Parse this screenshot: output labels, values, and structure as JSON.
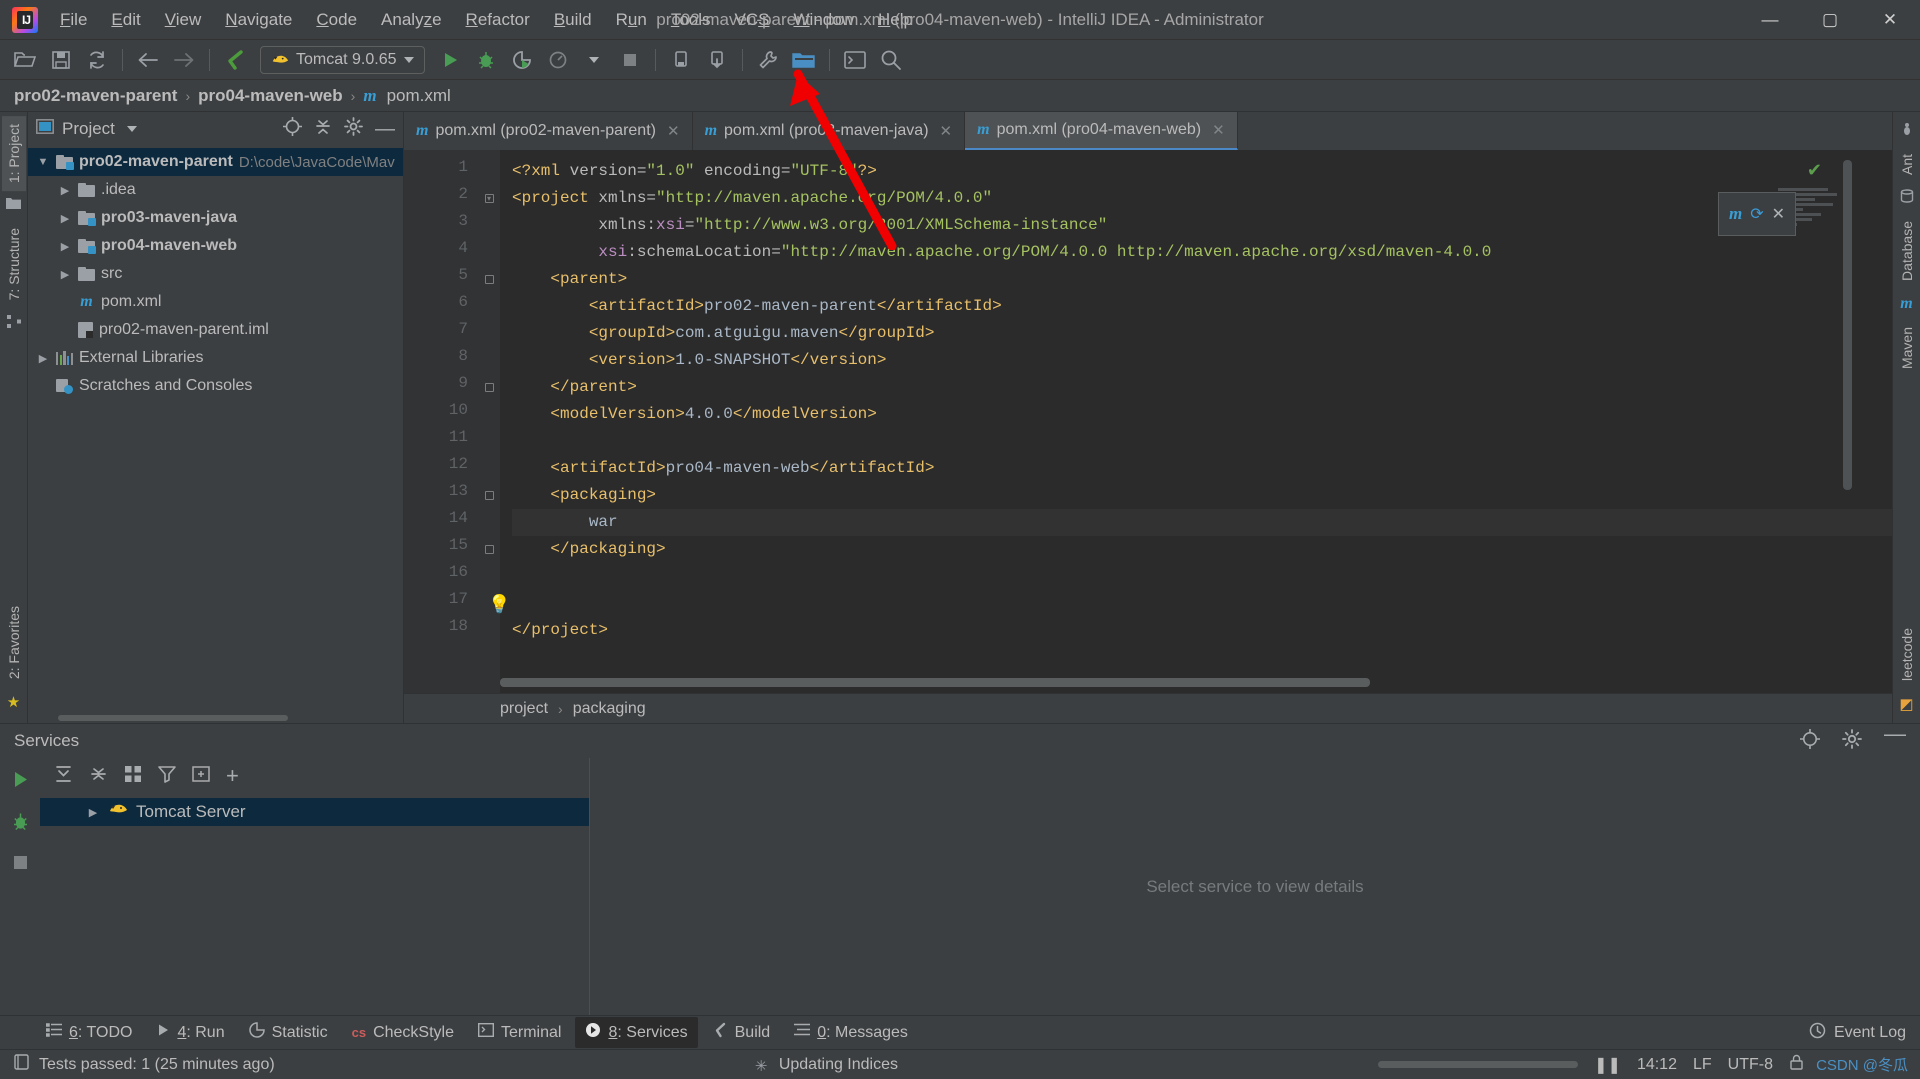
{
  "window": {
    "title": "pro02-maven-parent - pom.xml (pro04-maven-web) - IntelliJ IDEA - Administrator",
    "minimize": "—",
    "maximize": "▢",
    "close": "✕",
    "logo_text": "IJ"
  },
  "menubar": {
    "items": [
      {
        "label": "File",
        "mnemonic": "F"
      },
      {
        "label": "Edit",
        "mnemonic": "E"
      },
      {
        "label": "View",
        "mnemonic": "V"
      },
      {
        "label": "Navigate",
        "mnemonic": "N"
      },
      {
        "label": "Code",
        "mnemonic": "C"
      },
      {
        "label": "Analyze",
        "mnemonic": "z"
      },
      {
        "label": "Refactor",
        "mnemonic": "R"
      },
      {
        "label": "Build",
        "mnemonic": "B"
      },
      {
        "label": "Run",
        "mnemonic": "u"
      },
      {
        "label": "Tools",
        "mnemonic": "T"
      },
      {
        "label": "VCS",
        "mnemonic": "S"
      },
      {
        "label": "Window",
        "mnemonic": "W"
      },
      {
        "label": "Help",
        "mnemonic": "H"
      }
    ]
  },
  "toolbar": {
    "open_label": "open-folder-icon",
    "save_label": "save-all-icon",
    "sync_label": "synchronize-icon",
    "back_label": "back-icon",
    "forward_label": "forward-icon",
    "build_label": "build-icon",
    "run_config": "Tomcat 9.0.65",
    "run_label": "run-icon",
    "debug_label": "debug-icon",
    "run_coverage_label": "run-with-coverage-icon",
    "profile_label": "profiler-icon",
    "stop_label": "stop-icon",
    "device_label": "device-manager-icon",
    "update_label": "update-project-icon",
    "settings_label": "settings-icon",
    "project_structure_label": "project-structure-icon",
    "terminal_label": "terminal-icon",
    "search_label": "search-everywhere-icon"
  },
  "breadcrumbs": {
    "items": [
      {
        "label": "pro02-maven-parent",
        "bold": true,
        "icon": ""
      },
      {
        "label": "pro04-maven-web",
        "bold": true,
        "icon": ""
      },
      {
        "label": "pom.xml",
        "bold": false,
        "icon": "m"
      }
    ],
    "separator": "›"
  },
  "left_strip": {
    "tabs": [
      "1: Project",
      "7: Structure"
    ],
    "icons": [
      "project-icon",
      "structure-icon",
      "favorites-star-icon"
    ],
    "favorites": "2: Favorites"
  },
  "right_strip": {
    "tabs": [
      "Ant",
      "Database",
      "Maven",
      "leetcode"
    ],
    "icons": [
      "ant-icon",
      "database-icon",
      "maven-icon",
      "leetcode-icon"
    ]
  },
  "project_panel": {
    "title": "Project",
    "dropdown": "▾",
    "header_icons": [
      "locate-icon",
      "collapse-all-icon",
      "gear-icon",
      "hide-icon"
    ],
    "tree": [
      {
        "label": "pro02-maven-parent",
        "path": "D:\\code\\JavaCode\\Mav",
        "icon": "module-folder",
        "indent": 0,
        "arrow": "open",
        "bold": true,
        "selected": true
      },
      {
        "label": ".idea",
        "path": "",
        "icon": "folder",
        "indent": 1,
        "arrow": "closed",
        "bold": false,
        "selected": false
      },
      {
        "label": "pro03-maven-java",
        "path": "",
        "icon": "module-folder",
        "indent": 1,
        "arrow": "closed",
        "bold": true,
        "selected": false
      },
      {
        "label": "pro04-maven-web",
        "path": "",
        "icon": "module-folder",
        "indent": 1,
        "arrow": "closed",
        "bold": true,
        "selected": false
      },
      {
        "label": "src",
        "path": "",
        "icon": "folder",
        "indent": 1,
        "arrow": "closed",
        "bold": false,
        "selected": false
      },
      {
        "label": "pom.xml",
        "path": "",
        "icon": "maven-m",
        "indent": 1,
        "arrow": "none",
        "bold": false,
        "selected": false
      },
      {
        "label": "pro02-maven-parent.iml",
        "path": "",
        "icon": "iml-file",
        "indent": 1,
        "arrow": "none",
        "bold": false,
        "selected": false
      },
      {
        "label": "External Libraries",
        "path": "",
        "icon": "libraries",
        "indent": 0,
        "arrow": "closed",
        "bold": false,
        "selected": false
      },
      {
        "label": "Scratches and Consoles",
        "path": "",
        "icon": "scratches",
        "indent": 0,
        "arrow": "none",
        "bold": false,
        "selected": false
      }
    ]
  },
  "editor": {
    "tabs": [
      {
        "label": "pom.xml (pro02-maven-parent)",
        "icon": "m",
        "active": false,
        "close": "✕"
      },
      {
        "label": "pom.xml (pro03-maven-java)",
        "icon": "m",
        "active": false,
        "close": "✕"
      },
      {
        "label": "pom.xml (pro04-maven-web)",
        "icon": "m",
        "active": true,
        "close": "✕"
      }
    ],
    "line_numbers": [
      1,
      2,
      3,
      4,
      5,
      6,
      7,
      8,
      9,
      10,
      11,
      12,
      13,
      14,
      15,
      16,
      17,
      18
    ],
    "bulb_line": 14,
    "bulb_icon": "💡",
    "inspection_status": "✔",
    "code_lines": [
      {
        "n": 1,
        "tokens": [
          {
            "t": "<?xml ",
            "c": "t-pi"
          },
          {
            "t": "version=",
            "c": "t-attr"
          },
          {
            "t": "\"1.0\"",
            "c": "t-val"
          },
          {
            "t": " encoding=",
            "c": "t-attr"
          },
          {
            "t": "\"UTF-8\"",
            "c": "t-val"
          },
          {
            "t": "?>",
            "c": "t-pi"
          }
        ]
      },
      {
        "n": 2,
        "tokens": [
          {
            "t": "<project ",
            "c": "t-tag"
          },
          {
            "t": "xmlns=",
            "c": "t-attr"
          },
          {
            "t": "\"http://maven.apache.org/POM/4.0.0\"",
            "c": "t-val"
          }
        ]
      },
      {
        "n": 3,
        "tokens": [
          {
            "t": "         xmlns:",
            "c": "t-attr"
          },
          {
            "t": "xsi",
            "c": "t-ns"
          },
          {
            "t": "=",
            "c": "t-attr"
          },
          {
            "t": "\"http://www.w3.org/2001/XMLSchema-instance\"",
            "c": "t-val"
          }
        ]
      },
      {
        "n": 4,
        "tokens": [
          {
            "t": "         ",
            "c": "t-attr"
          },
          {
            "t": "xsi",
            "c": "t-ns"
          },
          {
            "t": ":schemaLocation=",
            "c": "t-attr"
          },
          {
            "t": "\"http://maven.apache.org/POM/4.0.0 http://maven.apache.org/xsd/maven-4.0.0",
            "c": "t-val"
          }
        ]
      },
      {
        "n": 5,
        "tokens": [
          {
            "t": "    <parent>",
            "c": "t-tag"
          }
        ]
      },
      {
        "n": 6,
        "tokens": [
          {
            "t": "        <artifactId>",
            "c": "t-tag"
          },
          {
            "t": "pro02-maven-parent",
            "c": "t-text"
          },
          {
            "t": "</artifactId>",
            "c": "t-tag"
          }
        ]
      },
      {
        "n": 7,
        "tokens": [
          {
            "t": "        <groupId>",
            "c": "t-tag"
          },
          {
            "t": "com.atguigu.maven",
            "c": "t-text"
          },
          {
            "t": "</groupId>",
            "c": "t-tag"
          }
        ]
      },
      {
        "n": 8,
        "tokens": [
          {
            "t": "        <version>",
            "c": "t-tag"
          },
          {
            "t": "1.0-SNAPSHOT",
            "c": "t-text"
          },
          {
            "t": "</version>",
            "c": "t-tag"
          }
        ]
      },
      {
        "n": 9,
        "tokens": [
          {
            "t": "    </parent>",
            "c": "t-tag"
          }
        ]
      },
      {
        "n": 10,
        "tokens": [
          {
            "t": "    <modelVersion>",
            "c": "t-tag"
          },
          {
            "t": "4.0.0",
            "c": "t-text"
          },
          {
            "t": "</modelVersion>",
            "c": "t-tag"
          }
        ]
      },
      {
        "n": 11,
        "tokens": [
          {
            "t": "",
            "c": "t-plain"
          }
        ]
      },
      {
        "n": 12,
        "tokens": [
          {
            "t": "    <artifactId>",
            "c": "t-tag"
          },
          {
            "t": "pro04-maven-web",
            "c": "t-text"
          },
          {
            "t": "</artifactId>",
            "c": "t-tag"
          }
        ]
      },
      {
        "n": 13,
        "tokens": [
          {
            "t": "    <packaging>",
            "c": "t-tag"
          }
        ]
      },
      {
        "n": 14,
        "tokens": [
          {
            "t": "        war",
            "c": "t-text"
          }
        ]
      },
      {
        "n": 15,
        "tokens": [
          {
            "t": "    </packaging>",
            "c": "t-tag"
          }
        ]
      },
      {
        "n": 16,
        "tokens": [
          {
            "t": "",
            "c": "t-plain"
          }
        ]
      },
      {
        "n": 17,
        "tokens": [
          {
            "t": "",
            "c": "t-plain"
          }
        ]
      },
      {
        "n": 18,
        "tokens": [
          {
            "t": "</project>",
            "c": "t-tag"
          }
        ]
      }
    ],
    "bottom_breadcrumbs": [
      "project",
      "packaging"
    ],
    "bottom_breadcrumb_sep": "›",
    "float_window": {
      "icon": "m",
      "refresh": "refresh-icon",
      "close": "✕"
    }
  },
  "services": {
    "title": "Services",
    "header_icons": [
      "locate-icon",
      "gear-icon",
      "hide-icon"
    ],
    "rail_icons": [
      "run-icon",
      "debug-icon",
      "stop-icon"
    ],
    "toolbar_icons": [
      "expand-all-icon",
      "collapse-all-icon",
      "group-icon",
      "filter-icon",
      "add-tab-icon",
      "add-icon"
    ],
    "tree": [
      {
        "label": "Tomcat Server",
        "icon": "tomcat-cat",
        "arrow": "closed",
        "selected": true
      }
    ],
    "detail_placeholder": "Select service to view details"
  },
  "bottom_tabs": [
    {
      "label": "6: TODO",
      "mnemonic": "6",
      "icon": "todo-icon",
      "active": false
    },
    {
      "label": "4: Run",
      "mnemonic": "4",
      "icon": "run-icon",
      "active": false
    },
    {
      "label": "Statistic",
      "mnemonic": "",
      "icon": "statistic-icon",
      "active": false
    },
    {
      "label": "CheckStyle",
      "mnemonic": "",
      "icon": "checkstyle-icon",
      "active": false
    },
    {
      "label": "Terminal",
      "mnemonic": "",
      "icon": "terminal-icon",
      "active": false
    },
    {
      "label": "8: Services",
      "mnemonic": "8",
      "icon": "services-icon",
      "active": true
    },
    {
      "label": "Build",
      "mnemonic": "",
      "icon": "build-icon",
      "active": false
    },
    {
      "label": "0: Messages",
      "mnemonic": "0",
      "icon": "messages-icon",
      "active": false
    }
  ],
  "event_log": {
    "label": "Event Log",
    "icon": "event-log-icon"
  },
  "statusbar": {
    "tests_message": "Tests passed: 1 (25 minutes ago)",
    "tests_icon": "test-icon",
    "indexing_message": "Updating Indices",
    "pause_icon": "❚❚",
    "caret_position": "14:12",
    "line_separator": "LF",
    "encoding": "UTF-8",
    "lock_icon": "🔒",
    "watermark": "CSDN @冬瓜"
  },
  "colors": {
    "window_bg": "#3c3f41",
    "editor_bg": "#2b2b2b",
    "gutter_bg": "#313335",
    "selection_blue": "#0d293e",
    "accent_blue": "#4a88c7",
    "maven_blue": "#389fd6",
    "string_green": "#a5c261",
    "tag_yellow": "#e8bf6a",
    "text_default": "#a9b7c6",
    "arrow_red": "#f00000"
  }
}
